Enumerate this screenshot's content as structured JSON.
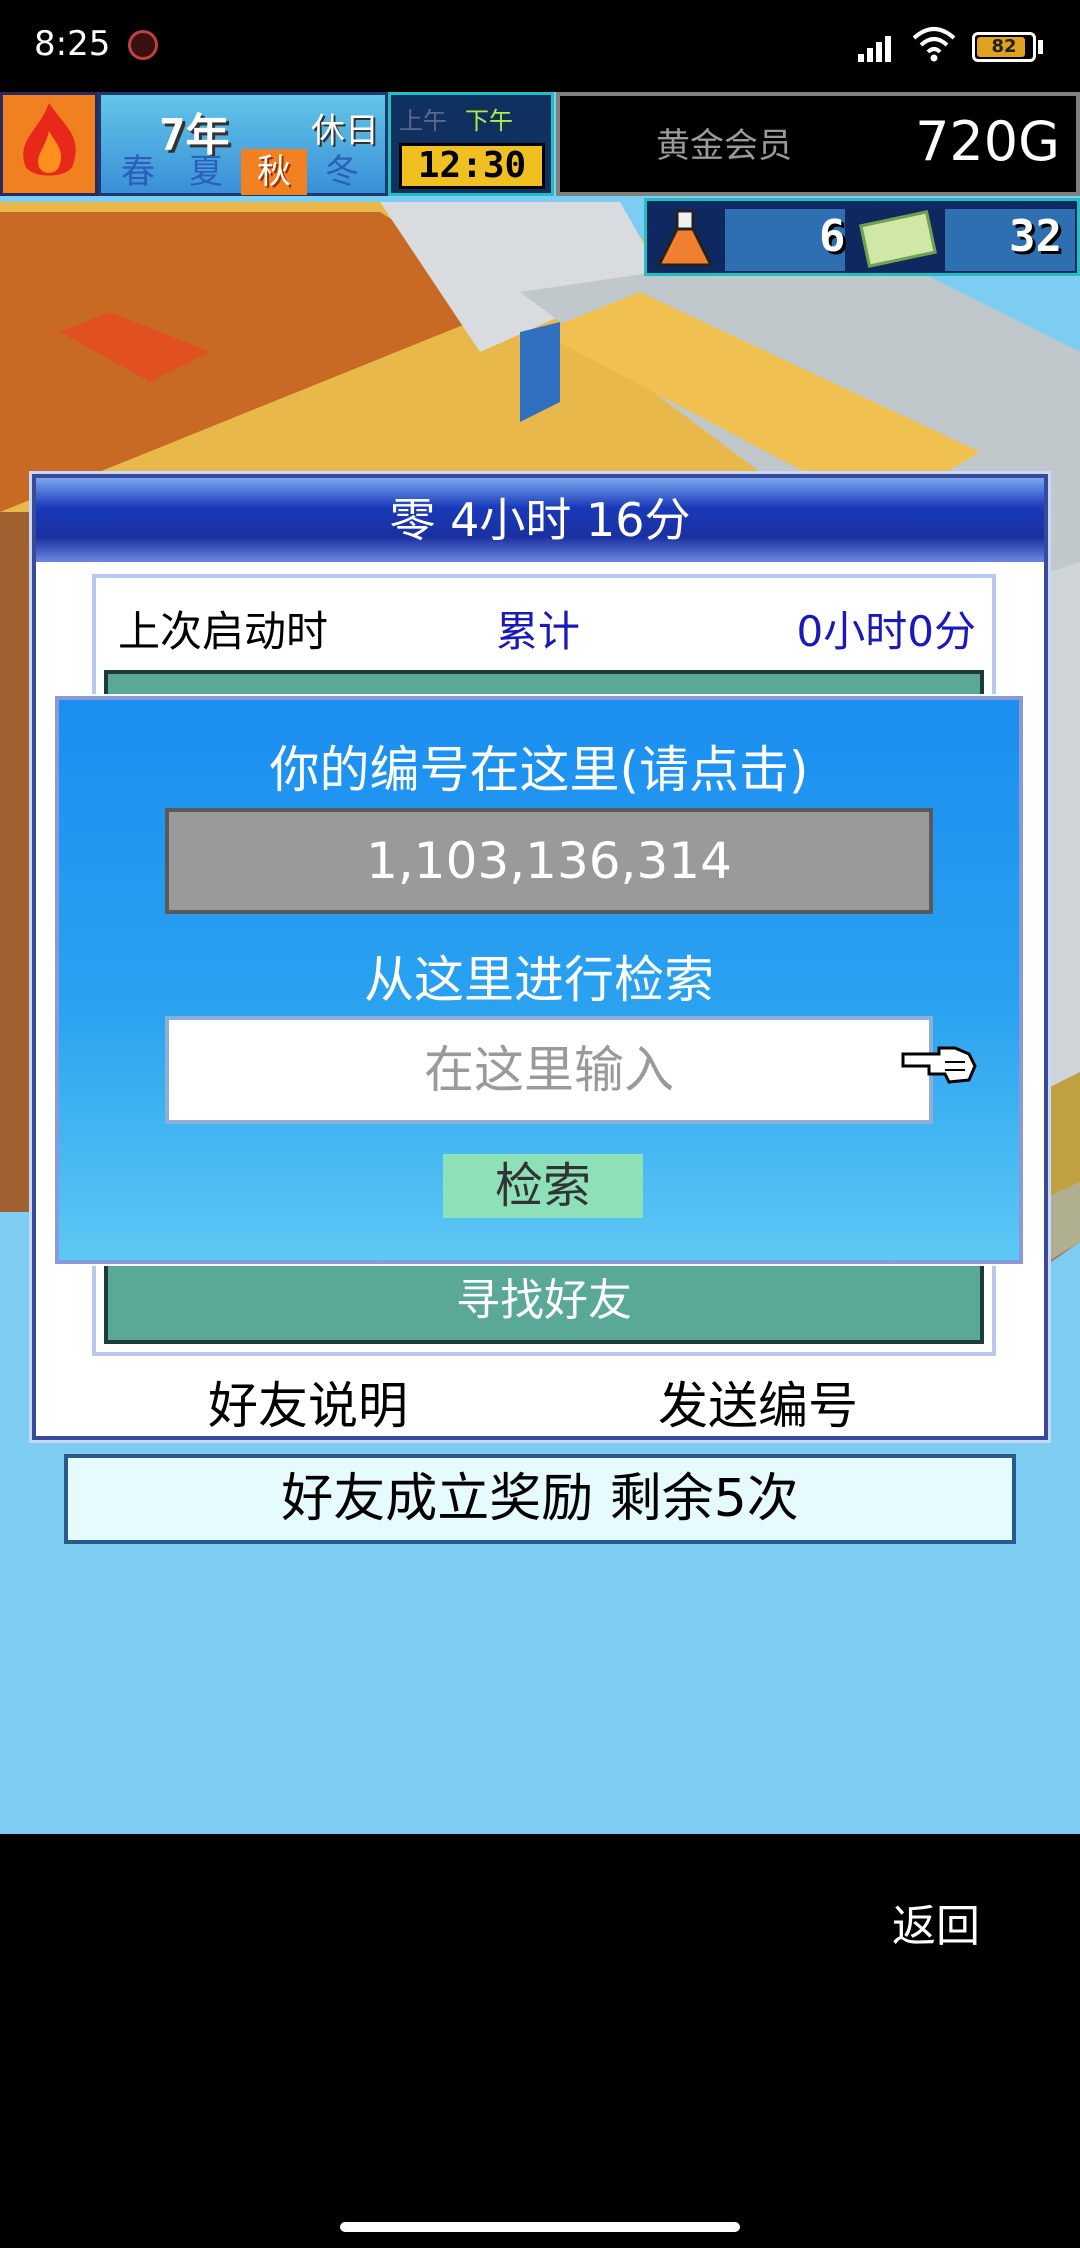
{
  "status_bar": {
    "time": "8:25",
    "battery_level": "82"
  },
  "hud": {
    "year": "7年",
    "holiday": "休日",
    "seasons": [
      "春",
      "夏",
      "秋",
      "冬"
    ],
    "active_season": "秋",
    "am": "上午",
    "pm": "下午",
    "clock": "12:30",
    "member_label": "黄金会员",
    "money": "720G",
    "research_points": "6",
    "tickets": "32"
  },
  "dialog": {
    "title": "零  4小时 16分",
    "last_launch_label": "上次启动时",
    "total_label": "累计",
    "total_value": "0小时0分",
    "find_friend_label": "寻找好友",
    "friend_help_button": "好友说明",
    "send_id_button": "发送编号"
  },
  "search_popup": {
    "title": "你的编号在这里(请点击)",
    "id_value": "1,103,136,314",
    "subtitle": "从这里进行检索",
    "input_placeholder": "在这里输入",
    "search_button": "检索"
  },
  "reward_bar": {
    "text": "好友成立奖励  剩余5次"
  },
  "nav": {
    "back_label": "返回"
  }
}
